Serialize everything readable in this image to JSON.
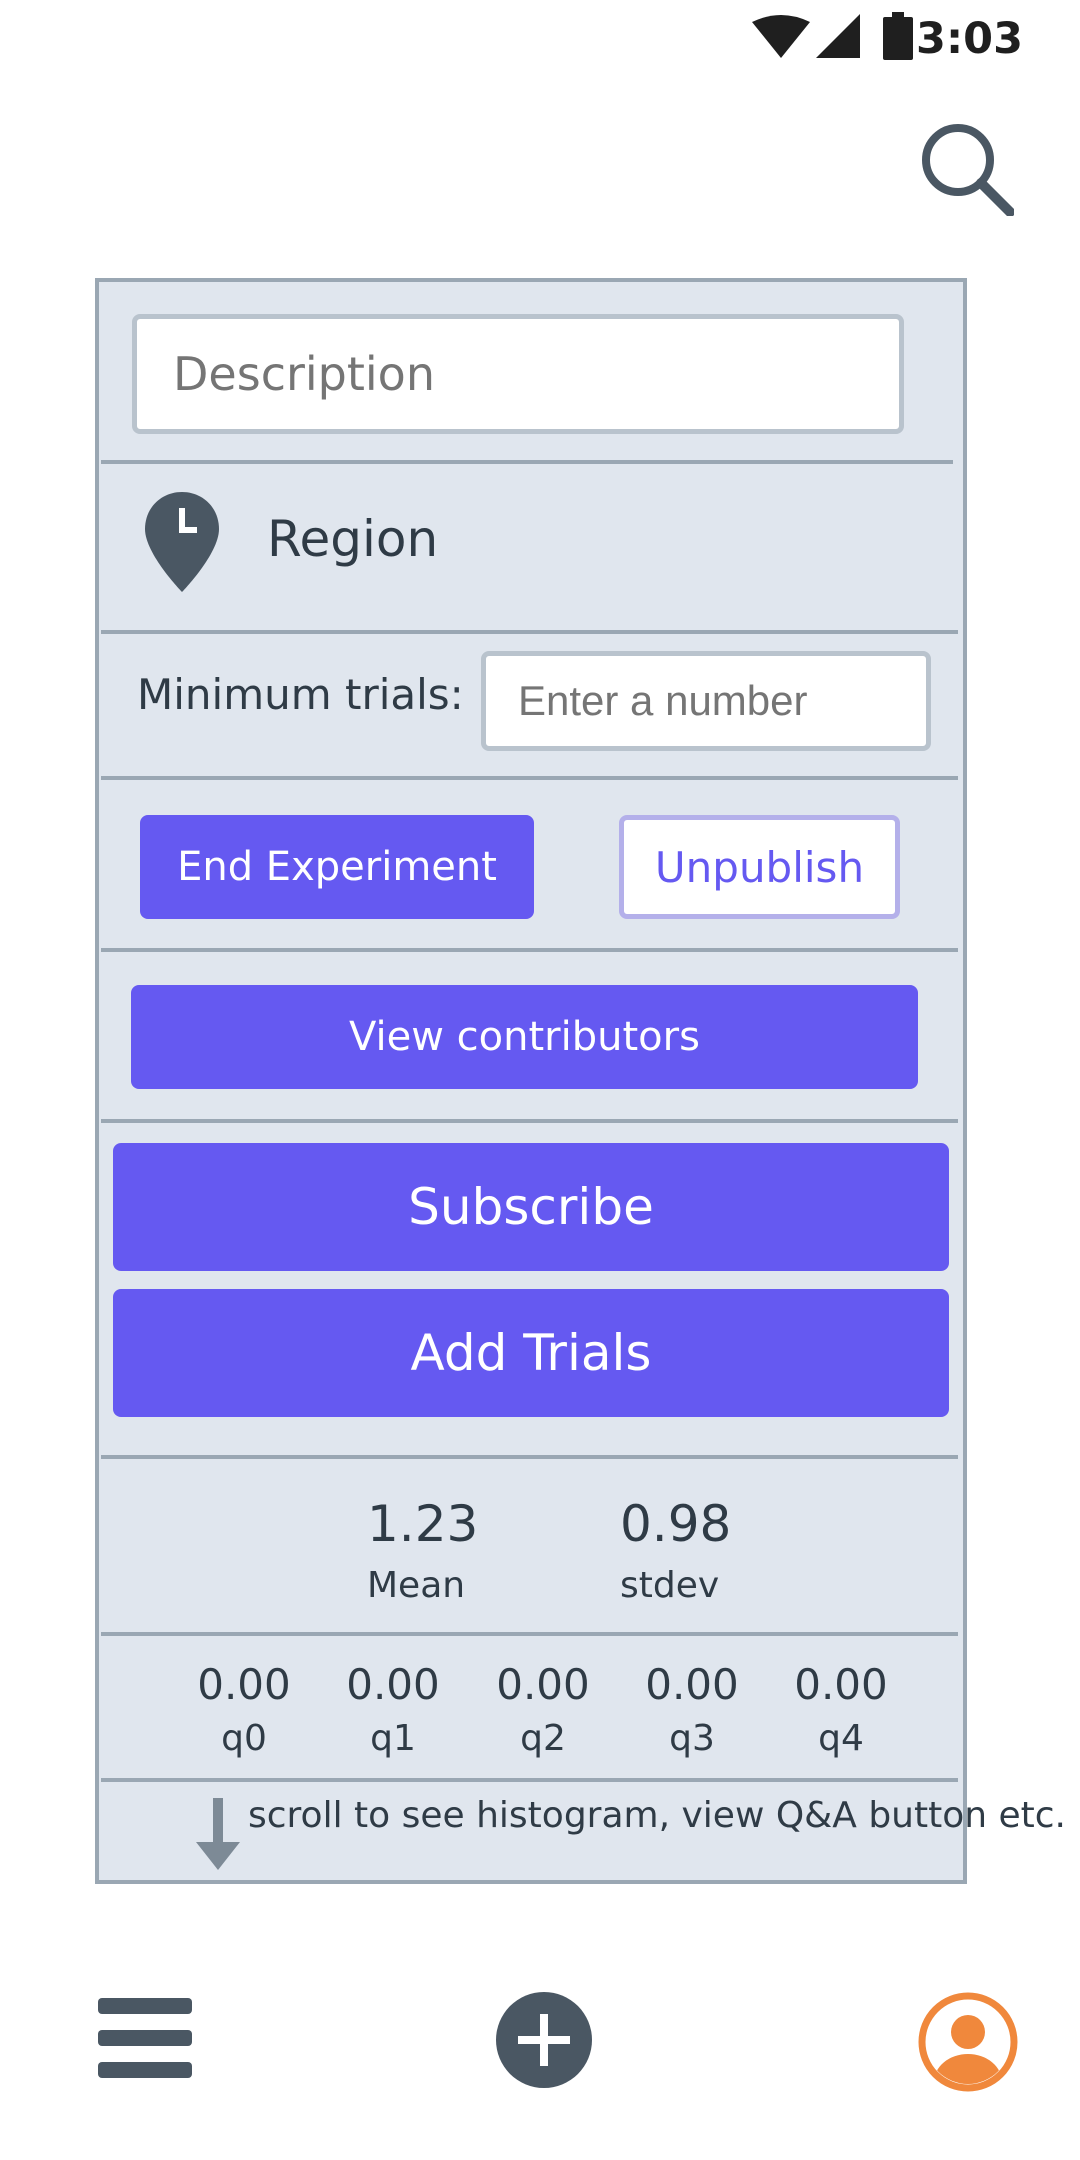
{
  "status_bar": {
    "time": "3:03"
  },
  "header": {
    "search_icon": "search-icon"
  },
  "form": {
    "description_placeholder": "Description",
    "region_label": "Region",
    "minimum_trials_label": "Minimum trials:",
    "minimum_trials_placeholder": "Enter a number"
  },
  "actions": {
    "end_experiment": "End Experiment",
    "unpublish": "Unpublish",
    "view_contributors": "View contributors",
    "subscribe": "Subscribe",
    "add_trials": "Add Trials"
  },
  "stats": {
    "mean_value": "1.23",
    "mean_label": "Mean",
    "stdev_value": "0.98",
    "stdev_label": "stdev",
    "quartiles": [
      {
        "value": "0.00",
        "label": "q0"
      },
      {
        "value": "0.00",
        "label": "q1"
      },
      {
        "value": "0.00",
        "label": "q2"
      },
      {
        "value": "0.00",
        "label": "q3"
      },
      {
        "value": "0.00",
        "label": "q4"
      }
    ]
  },
  "hint": {
    "scroll_text": "scroll to see histogram, view Q&A button etc."
  },
  "colors": {
    "accent": "#6559f1",
    "card_bg": "#e0e6ee",
    "profile": "#f0883c",
    "dark": "#4a5763"
  }
}
